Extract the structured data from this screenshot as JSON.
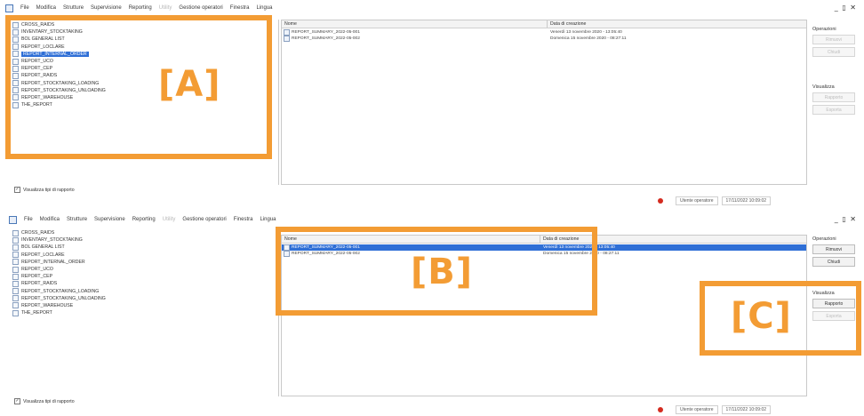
{
  "menu": [
    "File",
    "Modifica",
    "Strutture",
    "Supervisione",
    "Reporting",
    "Utility",
    "Gestione operatori",
    "Finestra",
    "Lingua"
  ],
  "menu_disabled_index": 5,
  "window_controls": "_ ▯ ✕",
  "tree_items": [
    "CROSS_RAIDS",
    "INVENTARY_STOCKTAKING",
    "BOL GENERAL LIST",
    "REPORT_LOCLARE",
    "REPORT_INTERNAL_ORDER",
    "REPORT_UCO",
    "REPORT_CEP",
    "REPORT_RAIDS",
    "REPORT_STOCKTAKING_LOADING",
    "REPORT_STOCKTAKING_UNLOADING",
    "REPORT_WAREHOUSE",
    "THE_REPORT"
  ],
  "selected_tree_index_top": 4,
  "list": {
    "col_name": "Nome",
    "col_date": "Data di creazione",
    "rows": [
      {
        "name": "REPORT_SUMMARY_2022-05-001",
        "date": "Venerdì 13 novembre 2020 - 13:05:40"
      },
      {
        "name": "REPORT_SUMMARY_2022-05-002",
        "date": "Domenica 15 novembre 2020 - 08:27:11"
      }
    ]
  },
  "buttons": {
    "ops_label": "Operazioni",
    "ops_btn1": "Rimuovi",
    "ops_btn2": "Chiudi",
    "view_label": "Visualizza",
    "view_btn1": "Rapporto",
    "view_btn2": "Esporta"
  },
  "show_all_checkbox": "Visualizza tipi di rapporto",
  "status": {
    "user": "Utente operatore",
    "datetime": "17/11/2022 10:09:02"
  },
  "callouts": {
    "a": "[A]",
    "b": "[B]",
    "c": "[C]"
  },
  "colors": {
    "callout": "#f39c34",
    "selection": "#2f6fd6",
    "status_dot": "#d42b1f"
  }
}
